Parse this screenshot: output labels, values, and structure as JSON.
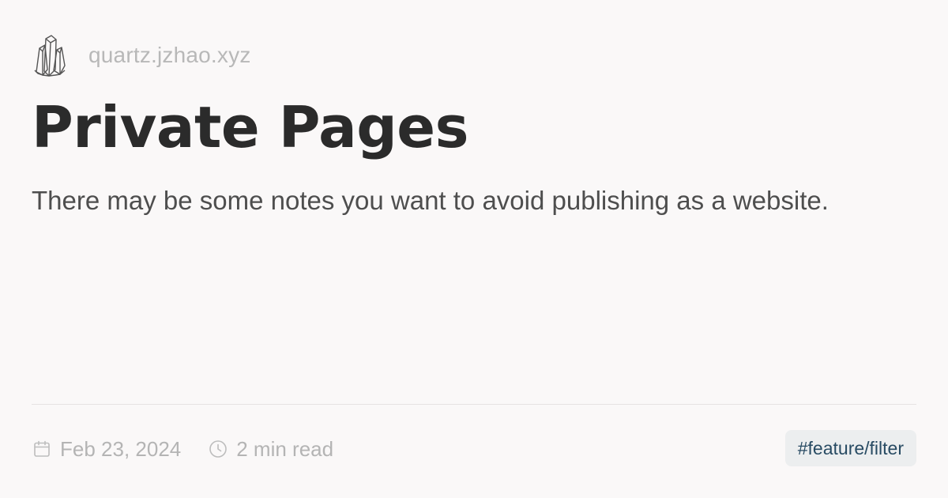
{
  "site": {
    "logo_icon": "crystal-cluster-icon",
    "name": "quartz.jzhao.xyz"
  },
  "page": {
    "title": "Private Pages",
    "description": "There may be some notes you want to avoid publishing as a website."
  },
  "meta": {
    "date_icon": "calendar-icon",
    "date": "Feb 23, 2024",
    "reading_time_icon": "clock-icon",
    "reading_time": "2 min read"
  },
  "tags": [
    "#feature/filter"
  ],
  "colors": {
    "background": "#faf8f8",
    "title": "#2b2b2b",
    "description": "#4e4e4e",
    "muted": "#b4b4b4",
    "tag_text": "#284b63",
    "tag_background": "#eceeef"
  }
}
